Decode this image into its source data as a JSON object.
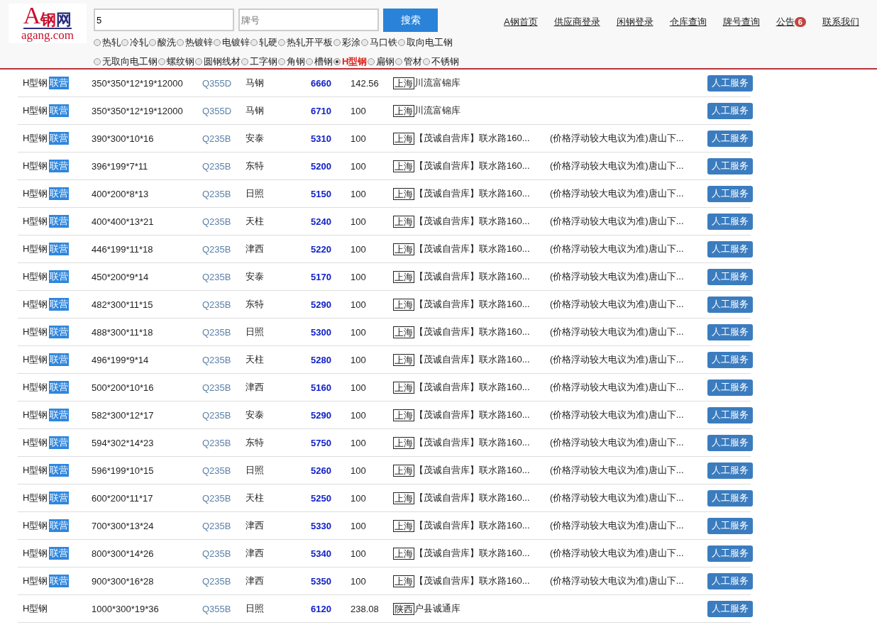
{
  "logo": {
    "mark": "A",
    "name_1": "钢",
    "name_2": "网",
    "domain": "agang.com"
  },
  "search": {
    "keyword_value": "5",
    "grade_placeholder": "牌号",
    "button": "搜索"
  },
  "nav": [
    {
      "label": "A钢首页"
    },
    {
      "label": "供应商登录"
    },
    {
      "label": "闲钢登录"
    },
    {
      "label": "仓库查询"
    },
    {
      "label": "牌号查询"
    },
    {
      "label": "公告",
      "badge": "6"
    },
    {
      "label": "联系我们"
    }
  ],
  "categories": [
    [
      {
        "label": "热轧",
        "selected": false
      },
      {
        "label": "冷轧",
        "selected": false
      },
      {
        "label": "酸洗",
        "selected": false
      },
      {
        "label": "热镀锌",
        "selected": false
      },
      {
        "label": "电镀锌",
        "selected": false
      },
      {
        "label": "轧硬",
        "selected": false
      },
      {
        "label": "热轧开平板",
        "selected": false
      },
      {
        "label": "彩涂",
        "selected": false
      },
      {
        "label": "马口铁",
        "selected": false
      },
      {
        "label": "取向电工钢",
        "selected": false
      }
    ],
    [
      {
        "label": "无取向电工钢",
        "selected": false
      },
      {
        "label": "螺纹钢",
        "selected": false
      },
      {
        "label": "圆钢线材",
        "selected": false
      },
      {
        "label": "工字钢",
        "selected": false
      },
      {
        "label": "角钢",
        "selected": false
      },
      {
        "label": "槽钢",
        "selected": false
      },
      {
        "label": "H型钢",
        "selected": true
      },
      {
        "label": "扁钢",
        "selected": false
      },
      {
        "label": "管材",
        "selected": false
      },
      {
        "label": "不锈钢",
        "selected": false
      }
    ]
  ],
  "rows": [
    {
      "product": "H型钢",
      "tag": "联营",
      "spec": "350*350*12*19*12000",
      "grade": "Q355D",
      "origin": "马钢",
      "price": "6660",
      "weight": "142.56",
      "region": "上海",
      "warehouse": "川流富锦库",
      "button": "人工服务"
    },
    {
      "product": "H型钢",
      "tag": "联营",
      "spec": "350*350*12*19*12000",
      "grade": "Q355D",
      "origin": "马钢",
      "price": "6710",
      "weight": "100",
      "region": "上海",
      "warehouse": "川流富锦库",
      "button": "人工服务"
    },
    {
      "product": "H型钢",
      "tag": "联营",
      "spec": "390*300*10*16",
      "grade": "Q235B",
      "origin": "安泰",
      "price": "5310",
      "weight": "100",
      "region": "上海",
      "warehouse": "【茂诚自营库】联水路160...",
      "detail": "(价格浮动较大电议为准)唐山下...",
      "button": "人工服务"
    },
    {
      "product": "H型钢",
      "tag": "联营",
      "spec": "396*199*7*11",
      "grade": "Q235B",
      "origin": "东特",
      "price": "5200",
      "weight": "100",
      "region": "上海",
      "warehouse": "【茂诚自营库】联水路160...",
      "detail": "(价格浮动较大电议为准)唐山下...",
      "button": "人工服务"
    },
    {
      "product": "H型钢",
      "tag": "联营",
      "spec": "400*200*8*13",
      "grade": "Q235B",
      "origin": "日照",
      "price": "5150",
      "weight": "100",
      "region": "上海",
      "warehouse": "【茂诚自营库】联水路160...",
      "detail": "(价格浮动较大电议为准)唐山下...",
      "button": "人工服务"
    },
    {
      "product": "H型钢",
      "tag": "联营",
      "spec": "400*400*13*21",
      "grade": "Q235B",
      "origin": "天柱",
      "price": "5240",
      "weight": "100",
      "region": "上海",
      "warehouse": "【茂诚自营库】联水路160...",
      "detail": "(价格浮动较大电议为准)唐山下...",
      "button": "人工服务"
    },
    {
      "product": "H型钢",
      "tag": "联营",
      "spec": "446*199*11*18",
      "grade": "Q235B",
      "origin": "津西",
      "price": "5220",
      "weight": "100",
      "region": "上海",
      "warehouse": "【茂诚自营库】联水路160...",
      "detail": "(价格浮动较大电议为准)唐山下...",
      "button": "人工服务"
    },
    {
      "product": "H型钢",
      "tag": "联营",
      "spec": "450*200*9*14",
      "grade": "Q235B",
      "origin": "安泰",
      "price": "5170",
      "weight": "100",
      "region": "上海",
      "warehouse": "【茂诚自营库】联水路160...",
      "detail": "(价格浮动较大电议为准)唐山下...",
      "button": "人工服务"
    },
    {
      "product": "H型钢",
      "tag": "联营",
      "spec": "482*300*11*15",
      "grade": "Q235B",
      "origin": "东特",
      "price": "5290",
      "weight": "100",
      "region": "上海",
      "warehouse": "【茂诚自营库】联水路160...",
      "detail": "(价格浮动较大电议为准)唐山下...",
      "button": "人工服务"
    },
    {
      "product": "H型钢",
      "tag": "联营",
      "spec": "488*300*11*18",
      "grade": "Q235B",
      "origin": "日照",
      "price": "5300",
      "weight": "100",
      "region": "上海",
      "warehouse": "【茂诚自营库】联水路160...",
      "detail": "(价格浮动较大电议为准)唐山下...",
      "button": "人工服务"
    },
    {
      "product": "H型钢",
      "tag": "联营",
      "spec": "496*199*9*14",
      "grade": "Q235B",
      "origin": "天柱",
      "price": "5280",
      "weight": "100",
      "region": "上海",
      "warehouse": "【茂诚自营库】联水路160...",
      "detail": "(价格浮动较大电议为准)唐山下...",
      "button": "人工服务"
    },
    {
      "product": "H型钢",
      "tag": "联营",
      "spec": "500*200*10*16",
      "grade": "Q235B",
      "origin": "津西",
      "price": "5160",
      "weight": "100",
      "region": "上海",
      "warehouse": "【茂诚自营库】联水路160...",
      "detail": "(价格浮动较大电议为准)唐山下...",
      "button": "人工服务"
    },
    {
      "product": "H型钢",
      "tag": "联营",
      "spec": "582*300*12*17",
      "grade": "Q235B",
      "origin": "安泰",
      "price": "5290",
      "weight": "100",
      "region": "上海",
      "warehouse": "【茂诚自营库】联水路160...",
      "detail": "(价格浮动较大电议为准)唐山下...",
      "button": "人工服务"
    },
    {
      "product": "H型钢",
      "tag": "联营",
      "spec": "594*302*14*23",
      "grade": "Q235B",
      "origin": "东特",
      "price": "5750",
      "weight": "100",
      "region": "上海",
      "warehouse": "【茂诚自营库】联水路160...",
      "detail": "(价格浮动较大电议为准)唐山下...",
      "button": "人工服务"
    },
    {
      "product": "H型钢",
      "tag": "联营",
      "spec": "596*199*10*15",
      "grade": "Q235B",
      "origin": "日照",
      "price": "5260",
      "weight": "100",
      "region": "上海",
      "warehouse": "【茂诚自营库】联水路160...",
      "detail": "(价格浮动较大电议为准)唐山下...",
      "button": "人工服务"
    },
    {
      "product": "H型钢",
      "tag": "联营",
      "spec": "600*200*11*17",
      "grade": "Q235B",
      "origin": "天柱",
      "price": "5250",
      "weight": "100",
      "region": "上海",
      "warehouse": "【茂诚自营库】联水路160...",
      "detail": "(价格浮动较大电议为准)唐山下...",
      "button": "人工服务"
    },
    {
      "product": "H型钢",
      "tag": "联营",
      "spec": "700*300*13*24",
      "grade": "Q235B",
      "origin": "津西",
      "price": "5330",
      "weight": "100",
      "region": "上海",
      "warehouse": "【茂诚自营库】联水路160...",
      "detail": "(价格浮动较大电议为准)唐山下...",
      "button": "人工服务"
    },
    {
      "product": "H型钢",
      "tag": "联营",
      "spec": "800*300*14*26",
      "grade": "Q235B",
      "origin": "津西",
      "price": "5340",
      "weight": "100",
      "region": "上海",
      "warehouse": "【茂诚自营库】联水路160...",
      "detail": "(价格浮动较大电议为准)唐山下...",
      "button": "人工服务"
    },
    {
      "product": "H型钢",
      "tag": "联营",
      "spec": "900*300*16*28",
      "grade": "Q235B",
      "origin": "津西",
      "price": "5350",
      "weight": "100",
      "region": "上海",
      "warehouse": "【茂诚自营库】联水路160...",
      "detail": "(价格浮动较大电议为准)唐山下...",
      "button": "人工服务"
    },
    {
      "product": "H型钢",
      "spec": "1000*300*19*36",
      "grade": "Q355B",
      "origin": "日照",
      "price": "6120",
      "weight": "238.08",
      "region": "陕西",
      "warehouse": "户县诚通库",
      "button": "人工服务"
    }
  ]
}
